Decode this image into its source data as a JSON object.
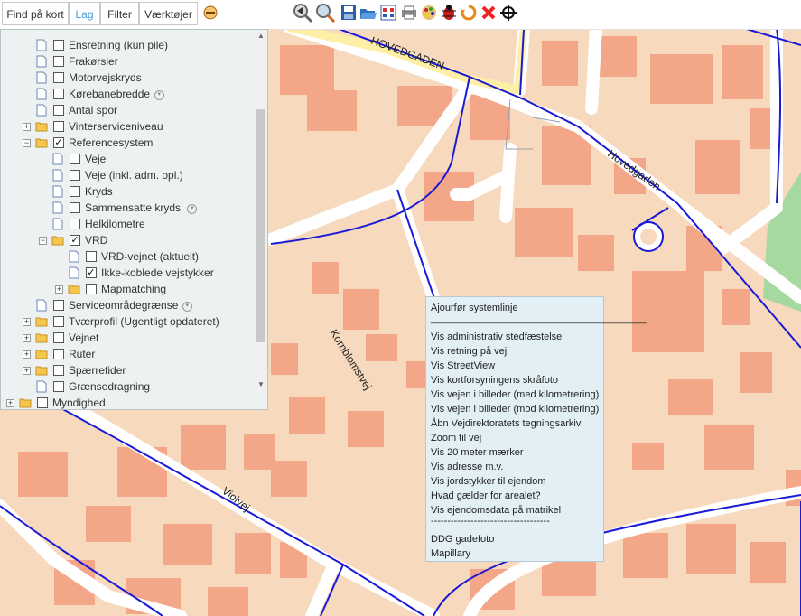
{
  "toolbar": {
    "tabs": [
      {
        "label": "Find på kort"
      },
      {
        "label": "Lag"
      },
      {
        "label": "Filter"
      },
      {
        "label": "Værktøjer"
      }
    ],
    "tools": [
      "minimize-icon",
      "zoom-back-icon",
      "zoom-icon",
      "save-icon",
      "open-folder-icon",
      "grid-icon",
      "print-icon",
      "palette-icon",
      "bug-icon",
      "refresh-icon",
      "delete-icon",
      "crosshair-icon"
    ]
  },
  "layers": [
    {
      "label": "Ensretning (kun pile)",
      "checked": false,
      "folder": false,
      "expand": ""
    },
    {
      "label": "Frakørsler",
      "checked": false,
      "folder": false,
      "expand": ""
    },
    {
      "label": "Motorvejskryds",
      "checked": false,
      "folder": false,
      "expand": ""
    },
    {
      "label": "Kørebanebredde",
      "checked": false,
      "folder": false,
      "expand": "",
      "info": true
    },
    {
      "label": "Antal spor",
      "checked": false,
      "folder": false,
      "expand": ""
    },
    {
      "label": "Vinterserviceniveau",
      "checked": false,
      "folder": true,
      "expand": "+"
    },
    {
      "label": "Referencesystem",
      "checked": true,
      "folder": true,
      "expand": "−"
    },
    {
      "label": "Veje",
      "checked": false,
      "folder": false,
      "expand": ""
    },
    {
      "label": "Veje (inkl. adm. opl.)",
      "checked": false,
      "folder": false,
      "expand": ""
    },
    {
      "label": "Kryds",
      "checked": false,
      "folder": false,
      "expand": ""
    },
    {
      "label": "Sammensatte kryds",
      "checked": false,
      "folder": false,
      "expand": "",
      "info": true
    },
    {
      "label": "Helkilometre",
      "checked": false,
      "folder": false,
      "expand": ""
    },
    {
      "label": "VRD",
      "checked": true,
      "folder": true,
      "expand": "−"
    },
    {
      "label": "VRD-vejnet (aktuelt)",
      "checked": false,
      "folder": false,
      "expand": ""
    },
    {
      "label": "Ikke-koblede vejstykker",
      "checked": true,
      "folder": false,
      "expand": ""
    },
    {
      "label": "Mapmatching",
      "checked": false,
      "folder": true,
      "expand": "+"
    },
    {
      "label": "Serviceområdegrænse",
      "checked": false,
      "folder": false,
      "expand": "",
      "info": true
    },
    {
      "label": "Tværprofil (Ugentligt opdateret)",
      "checked": false,
      "folder": true,
      "expand": "+"
    },
    {
      "label": "Vejnet",
      "checked": false,
      "folder": true,
      "expand": "+"
    },
    {
      "label": "Ruter",
      "checked": false,
      "folder": true,
      "expand": "+"
    },
    {
      "label": "Spærrefider",
      "checked": false,
      "folder": true,
      "expand": "+"
    },
    {
      "label": "Grænsedragning",
      "checked": false,
      "folder": false,
      "expand": ""
    },
    {
      "label": "Myndighed",
      "checked": false,
      "folder": true,
      "expand": "+"
    }
  ],
  "context_menu": {
    "items": [
      "Ajourfør systemlinje",
      "_______________________________________",
      "Vis administrativ stedfæstelse",
      "Vis retning på vej",
      "Vis StreetView",
      "Vis kortforsyningens skråfoto",
      "Vis vejen i billeder (med kilometrering)",
      "Vis vejen i billeder (mod kilometrering)",
      "Åbn Vejdirektoratets tegningsarkiv",
      "Zoom til vej",
      "Vis 20 meter mærker",
      "Vis adresse m.v.",
      "Vis jordstykker til ejendom",
      "Hvad gælder for arealet?",
      "Vis ejendomsdata på matrikel",
      "------------------------------------",
      "DDG gadefoto",
      "Mapillary"
    ]
  },
  "map": {
    "road_labels": [
      "HOVEDGADEN",
      "Hovedgaden",
      "Kornblomstvej",
      "Violvej"
    ],
    "colors": {
      "background": "#f7d9bd",
      "building": "#f4a688",
      "road": "#ffffff",
      "road_line": "#1a1ad6",
      "major_road": "#fdf0a6",
      "green": "#a5d9a0"
    }
  }
}
